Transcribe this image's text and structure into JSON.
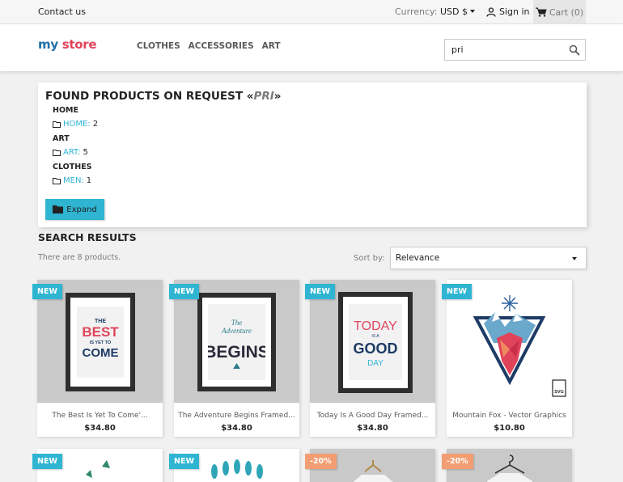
{
  "topbar": {
    "contact": "Contact us",
    "currency_label": "Currency:",
    "currency_value": "USD $",
    "signin": "Sign in",
    "cart": "Cart (0)"
  },
  "header": {
    "logo_a": "my ",
    "logo_b": "store",
    "menu": [
      "CLOTHES",
      "ACCESSORIES",
      "ART"
    ],
    "search_value": "pri"
  },
  "request": {
    "title_prefix": "FOUND PRODUCTS ON REQUEST «",
    "query": "PRI",
    "title_suffix": "»",
    "groups": [
      {
        "category": "HOME",
        "link": "HOME:",
        "count": "2"
      },
      {
        "category": "ART",
        "link": "ART:",
        "count": "5"
      },
      {
        "category": "CLOTHES",
        "link": "MEN:",
        "count": "1"
      }
    ],
    "expand": "Expand"
  },
  "results": {
    "title": "SEARCH RESULTS",
    "count": "There are 8 products.",
    "sort_label": "Sort by:",
    "sort_value": "Relevance"
  },
  "products": [
    {
      "flag": "NEW",
      "name": "The Best Is Yet To Come'...",
      "price": "$34.80",
      "poster": [
        "THE",
        "BEST",
        "IS YET TO",
        "COME"
      ]
    },
    {
      "flag": "NEW",
      "name": "The Adventure Begins Framed...",
      "price": "$34.80",
      "poster": [
        "The",
        "Adventure",
        "BEGINS"
      ]
    },
    {
      "flag": "NEW",
      "name": "Today Is A Good Day Framed...",
      "price": "$34.80",
      "poster": [
        "TODAY",
        "IS A",
        "GOOD",
        "DAY"
      ]
    },
    {
      "flag": "NEW",
      "name": "Mountain Fox - Vector Graphics",
      "price": "$10.80",
      "file_badge": "SVG"
    },
    {
      "flag": "NEW"
    },
    {
      "flag": "NEW"
    },
    {
      "flag": "-20%"
    },
    {
      "flag": "-20%"
    }
  ],
  "colors": {
    "accent": "#2fb5d2",
    "discount": "#f39d72",
    "poster_red": "#e0445b"
  }
}
